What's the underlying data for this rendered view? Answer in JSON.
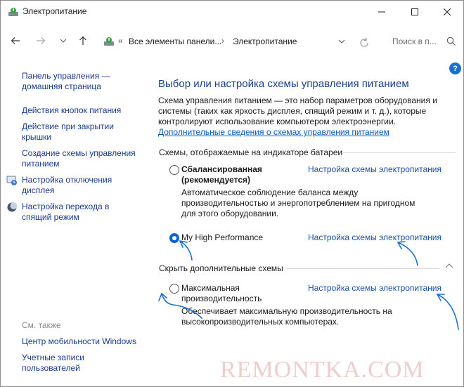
{
  "window": {
    "title": "Электропитание"
  },
  "titlebar_icons": {
    "minimize": "minimize-icon",
    "maximize": "maximize-icon",
    "close": "close-icon"
  },
  "address": {
    "crumbs": [
      "Все элементы панели...",
      "Электропитание"
    ],
    "separator": "›",
    "overflow": "«"
  },
  "search": {
    "placeholder": "Поиск в п..."
  },
  "sidebar": {
    "links": [
      "Панель управления — домашняя страница",
      "Действия кнопок питания",
      "Действие при закрытии крышки",
      "Создание схемы управления питанием",
      "Настройка отключения дисплея",
      "Настройка перехода в спящий режим"
    ],
    "see_also_heading": "См. также",
    "see_also": [
      "Центр мобильности Windows",
      "Учетные записи пользователей"
    ]
  },
  "main": {
    "help": "?",
    "title": "Выбор или настройка схемы управления питанием",
    "intro": "Схема управления питанием — это набор параметров оборудования и системы (таких как яркость дисплея, спящий режим и т. д.), которые контролируют использование компьютером электроэнергии.",
    "more_link": "Дополнительные сведения о схемах управления питанием",
    "battery_section": "Схемы, отображаемые на индикаторе батареи",
    "hidden_section": "Скрыть дополнительные схемы",
    "plan_settings_label": "Настройка схемы электропитания",
    "plans": [
      {
        "name": "Сбалансированная (рекомендуется)",
        "description": "Автоматическое соблюдение баланса между производительностью и энергопотреблением на пригодном для этого оборудовании.",
        "selected": false
      },
      {
        "name": "My High Performance",
        "description": "",
        "selected": true
      },
      {
        "name": "Максимальная производительность",
        "description": "Обеспечивает максимальную производительность на высокопроизводительных компьютерах.",
        "selected": false
      }
    ]
  },
  "colors": {
    "link": "#1a3a8e",
    "title": "#1a3e8f",
    "accent": "#0a64d2",
    "annotation": "#1a6fd6"
  },
  "watermark": "REMONTKA.COM"
}
